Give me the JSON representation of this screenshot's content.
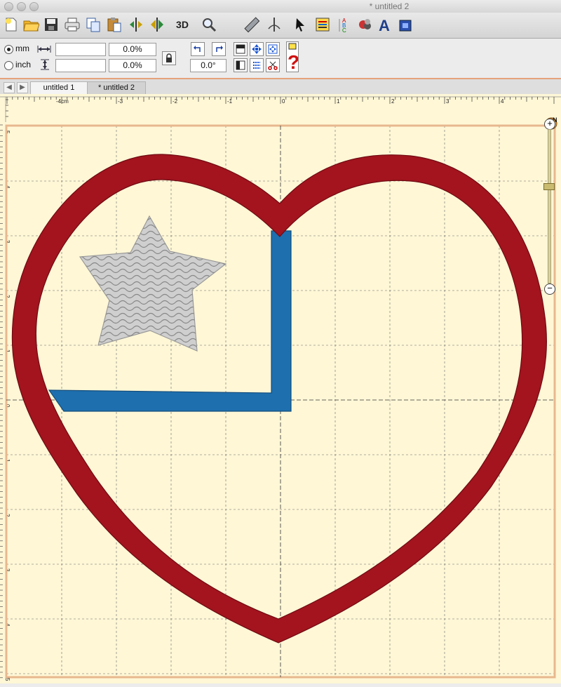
{
  "window": {
    "title": "* untitled 2"
  },
  "toolbar": {
    "tools": [
      "new-file-icon",
      "open-folder-icon",
      "save-icon",
      "print-icon",
      "copy-icon",
      "paste-icon",
      "mirror-horizontal-icon",
      "mirror-vertical-icon",
      "3d-view-icon",
      "zoom-magnifier-icon",
      "measure-ruler-icon",
      "stitch-simulator-icon",
      "select-arrow-icon",
      "properties-icon",
      "spell-check-icon",
      "color-icon",
      "text-icon",
      "hoop-icon"
    ],
    "label_3d": "3D"
  },
  "options": {
    "unit_mm": "mm",
    "unit_inch": "inch",
    "width_value": "",
    "height_value": "",
    "width_percent": "0.0%",
    "height_percent": "0.0%",
    "rotation": "0.0°",
    "selected_unit": "mm"
  },
  "tabs": [
    {
      "label": "untitled 1",
      "active": false
    },
    {
      "label": "* untitled 2",
      "active": true
    }
  ],
  "ruler": {
    "h_labels": [
      "-4cm",
      "-3",
      "-2",
      "-1",
      "0",
      "1",
      "2",
      "3",
      "4"
    ],
    "v_labels": [
      "5",
      "4",
      "3",
      "2",
      "1",
      "0",
      "1",
      "2",
      "3",
      "4",
      "5"
    ]
  },
  "compass": {
    "north": "N"
  },
  "colors": {
    "canvas": "#fff7d6",
    "heart": "#a3141e",
    "blue_bar": "#1e6fae",
    "star": "#c8c8c8",
    "hoop_border": "#e8b88e"
  }
}
